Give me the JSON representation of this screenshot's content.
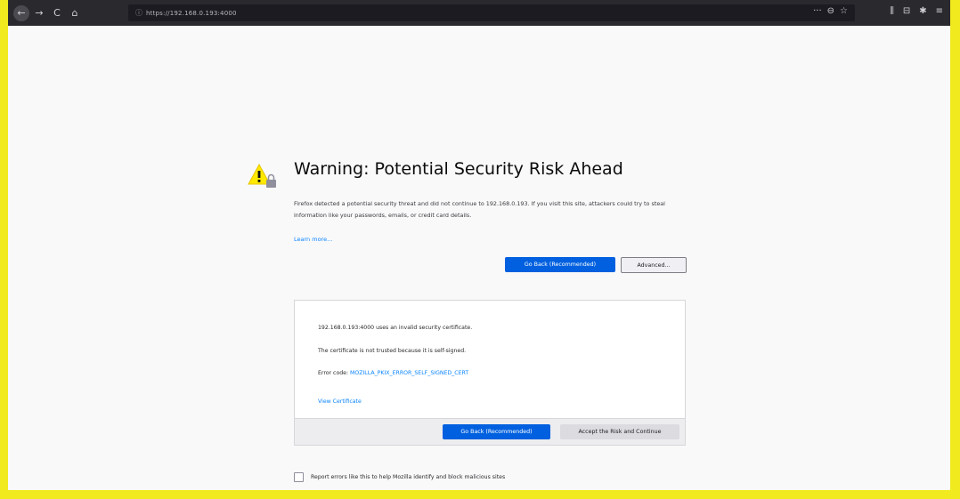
{
  "browser": {
    "url": "https://192.168.0.193:4000",
    "icons": [
      "back-icon",
      "forward-icon",
      "reload-icon",
      "home-icon",
      "more-icon",
      "pocket-icon",
      "bookmark-star-icon",
      "library-icon",
      "sidebar-icon",
      "extension-icon",
      "menu-icon"
    ],
    "nav": {
      "back": "←",
      "forward": "→",
      "reload": "C",
      "home": "⌂"
    },
    "page_actions": {
      "more": "···",
      "pocket": "⊖",
      "star": "☆"
    },
    "right": {
      "library": "⫼",
      "sidebar": "⊟",
      "extension": "✱",
      "menu": "≡"
    }
  },
  "warning": {
    "title": "Warning: Potential Security Risk Ahead",
    "description": "Firefox detected a potential security threat and did not continue to 192.168.0.193. If you visit this site, attackers could try to steal information like your passwords, emails, or credit card details.",
    "learn_more": "Learn more...",
    "go_back_label": "Go Back (Recommended)",
    "advanced_label": "Advanced..."
  },
  "advanced_panel": {
    "line1": "192.168.0.193:4000 uses an invalid security certificate.",
    "line2": "The certificate is not trusted because it is self-signed.",
    "error_code_label": "Error code:",
    "error_code": "MOZILLA_PKIX_ERROR_SELF_SIGNED_CERT",
    "view_certificate": "View Certificate",
    "go_back_label": "Go Back (Recommended)",
    "accept_label": "Accept the Risk and Continue"
  },
  "report": {
    "label": "Report errors like this to help Mozilla identify and block malicious sites",
    "checked": false
  },
  "colors": {
    "accent": "#0060df",
    "link": "#0a84ff",
    "warning_yellow": "#ffe900",
    "highlight_border": "#f0ea1e",
    "toolbar": "#2a2a2e"
  }
}
